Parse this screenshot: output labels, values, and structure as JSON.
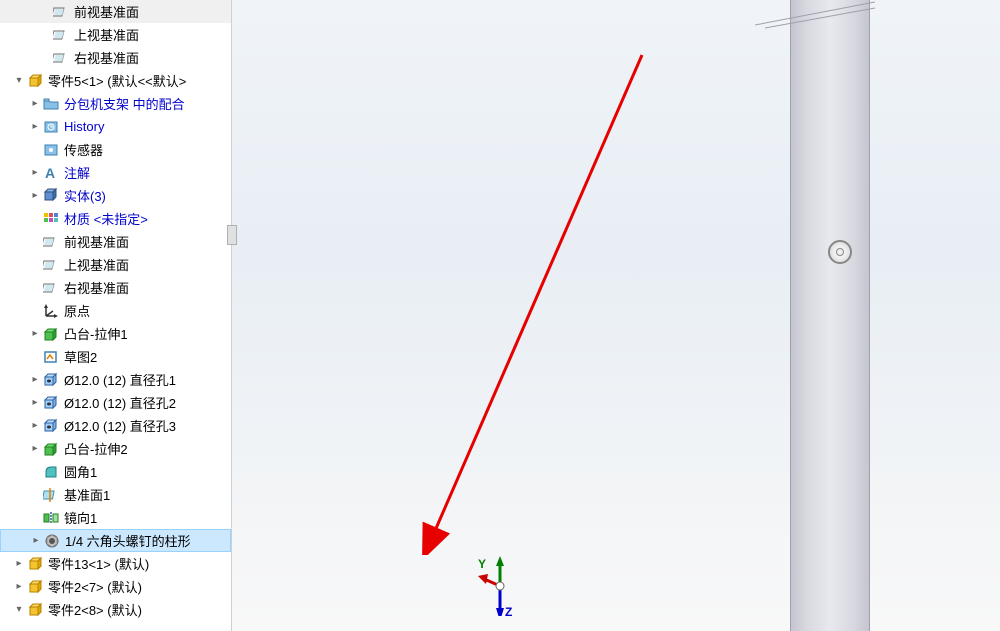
{
  "tree": {
    "items": [
      {
        "indent": 1,
        "expander": "",
        "icon": "plane",
        "label": "前视基准面",
        "color": "black",
        "interactable": true
      },
      {
        "indent": 1,
        "expander": "",
        "icon": "plane",
        "label": "上视基准面",
        "color": "black",
        "interactable": true
      },
      {
        "indent": 1,
        "expander": "",
        "icon": "plane",
        "label": "右视基准面",
        "color": "black",
        "interactable": true
      },
      {
        "indent": 2,
        "expander": "▾",
        "icon": "part",
        "label": "零件5<1> (默认<<默认>",
        "color": "black",
        "interactable": true
      },
      {
        "indent": 3,
        "expander": "▸",
        "icon": "folder",
        "label": "分包机支架 中的配合",
        "color": "blue",
        "interactable": true
      },
      {
        "indent": 3,
        "expander": "▸",
        "icon": "history",
        "label": "History",
        "color": "blue",
        "interactable": true
      },
      {
        "indent": 4,
        "expander": "",
        "icon": "sensor",
        "label": "传感器",
        "color": "black",
        "interactable": true
      },
      {
        "indent": 3,
        "expander": "▸",
        "icon": "annotation",
        "label": "注解",
        "color": "blue",
        "interactable": true
      },
      {
        "indent": 3,
        "expander": "▸",
        "icon": "solid",
        "label": "实体(3)",
        "color": "blue",
        "interactable": true
      },
      {
        "indent": 4,
        "expander": "",
        "icon": "material",
        "label": "材质 <未指定>",
        "color": "blue",
        "interactable": true
      },
      {
        "indent": 4,
        "expander": "",
        "icon": "plane",
        "label": "前视基准面",
        "color": "black",
        "interactable": true
      },
      {
        "indent": 4,
        "expander": "",
        "icon": "plane",
        "label": "上视基准面",
        "color": "black",
        "interactable": true
      },
      {
        "indent": 4,
        "expander": "",
        "icon": "plane",
        "label": "右视基准面",
        "color": "black",
        "interactable": true
      },
      {
        "indent": 4,
        "expander": "",
        "icon": "origin",
        "label": "原点",
        "color": "black",
        "interactable": true
      },
      {
        "indent": 3,
        "expander": "▸",
        "icon": "extrude",
        "label": "凸台-拉伸1",
        "color": "black",
        "interactable": true
      },
      {
        "indent": 4,
        "expander": "",
        "icon": "sketch",
        "label": "草图2",
        "color": "black",
        "interactable": true
      },
      {
        "indent": 3,
        "expander": "▸",
        "icon": "hole",
        "label": "Ø12.0 (12) 直径孔1",
        "color": "black",
        "interactable": true
      },
      {
        "indent": 3,
        "expander": "▸",
        "icon": "hole",
        "label": "Ø12.0 (12) 直径孔2",
        "color": "black",
        "interactable": true
      },
      {
        "indent": 3,
        "expander": "▸",
        "icon": "hole",
        "label": "Ø12.0 (12) 直径孔3",
        "color": "black",
        "interactable": true
      },
      {
        "indent": 3,
        "expander": "▸",
        "icon": "extrude",
        "label": "凸台-拉伸2",
        "color": "black",
        "interactable": true
      },
      {
        "indent": 4,
        "expander": "",
        "icon": "fillet",
        "label": "圆角1",
        "color": "black",
        "interactable": true
      },
      {
        "indent": 4,
        "expander": "",
        "icon": "refplane",
        "label": "基准面1",
        "color": "black",
        "interactable": true
      },
      {
        "indent": 4,
        "expander": "",
        "icon": "mirror",
        "label": "镜向1",
        "color": "black",
        "interactable": true
      },
      {
        "indent": 3,
        "expander": "▸",
        "icon": "holewizard",
        "label": "1/4 六角头螺钉的柱形",
        "color": "black",
        "interactable": true,
        "selected": true
      },
      {
        "indent": 2,
        "expander": "▸",
        "icon": "part",
        "label": "零件13<1> (默认)",
        "color": "black",
        "interactable": true
      },
      {
        "indent": 2,
        "expander": "▸",
        "icon": "part",
        "label": "零件2<7> (默认)",
        "color": "black",
        "interactable": true
      },
      {
        "indent": 2,
        "expander": "▾",
        "icon": "part",
        "label": "零件2<8> (默认)",
        "color": "black",
        "interactable": true
      }
    ]
  },
  "coord": {
    "y_label": "Y",
    "z_label": "Z"
  },
  "colors": {
    "tree_link_blue": "#0000cc",
    "selection_bg": "#cce8ff",
    "arrow_red": "#e60000"
  }
}
